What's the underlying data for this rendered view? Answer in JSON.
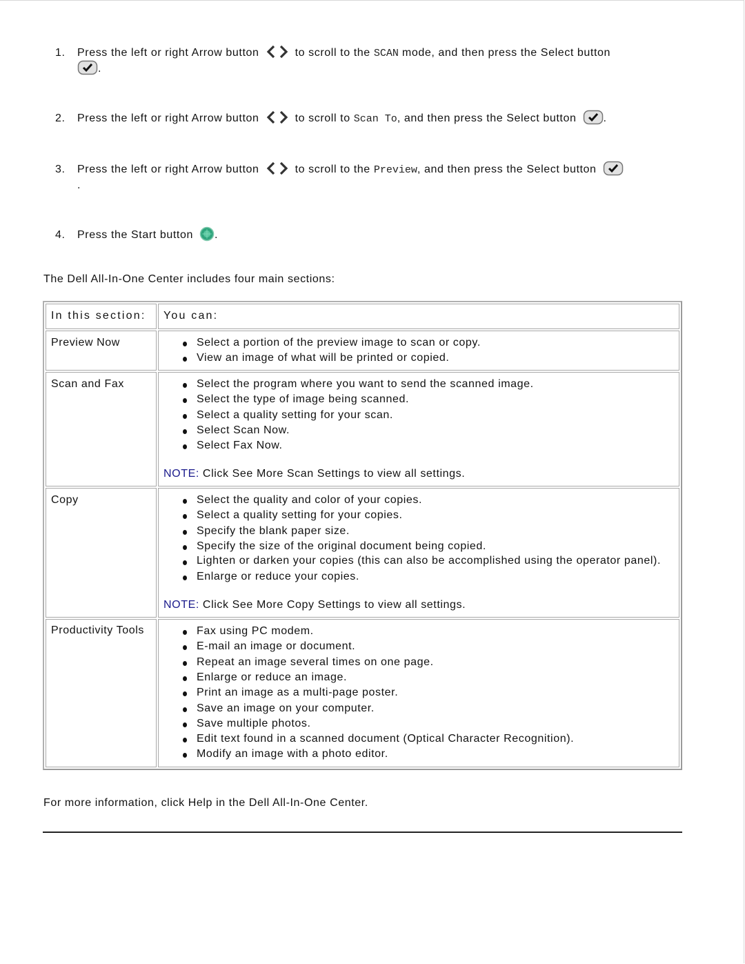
{
  "steps": [
    {
      "number": "1.",
      "text_a": "Press the left or right Arrow button",
      "text_b": "to scroll to the",
      "mode": "SCAN",
      "text_c": "mode, and then press the Select button",
      "text_end": "."
    },
    {
      "number": "2.",
      "text_a": "Press the left or right Arrow button",
      "text_b": "to scroll to",
      "mode": "Scan To",
      "text_c": ", and then press the Select button",
      "text_end": "."
    },
    {
      "number": "3.",
      "text_a": "Press the left or right Arrow button",
      "text_b": "to scroll to the",
      "mode": "Preview",
      "text_c": ", and then press the Select button",
      "text_end": "."
    },
    {
      "number": "4.",
      "text_a": "Press the Start button",
      "text_end": "."
    }
  ],
  "icons": {
    "arrow": "left-right-arrow-buttons",
    "select": "select-checkmark-button",
    "start": "start-button-green"
  },
  "intro": "The Dell All-In-One Center includes four main sections:",
  "table": {
    "headers": [
      "In this section:",
      "You can:"
    ],
    "rows": [
      {
        "section": "Preview Now",
        "items": [
          "Select a portion of the preview image to scan or copy.",
          "View an image of what will be printed or copied."
        ]
      },
      {
        "section": "Scan and Fax",
        "items": [
          "Select the program where you want to send the scanned image.",
          "Select the type of image being scanned.",
          "Select a quality setting for your scan.",
          "Select Scan Now.",
          "Select Fax Now."
        ],
        "note_label": "NOTE:",
        "note_text": " Click See More Scan Settings to view all settings."
      },
      {
        "section": "Copy",
        "items": [
          "Select the quality and color of your copies.",
          "Select a quality setting for your copies.",
          "Specify the blank paper size.",
          "Specify the size of the original document being copied.",
          "Lighten or darken your copies (this can also be accomplished using the operator panel).",
          "Enlarge or reduce your copies."
        ],
        "note_label": "NOTE:",
        "note_text": " Click See More Copy Settings to view all settings."
      },
      {
        "section": "Productivity Tools",
        "items": [
          "Fax using PC modem.",
          "E-mail an image or document.",
          "Repeat an image several times on one page.",
          "Enlarge or reduce an image.",
          "Print an image as a multi-page poster.",
          "Save an image on your computer.",
          "Save multiple photos.",
          "Edit text found in a scanned document (Optical Character Recognition).",
          "Modify an image with a photo editor."
        ]
      }
    ]
  },
  "footer": "For more information, click Help in the Dell All-In-One Center.",
  "colors": {
    "note_label": "#1a1a8c",
    "table_border": "#a8a8a8",
    "start_button": "#2fa57d"
  }
}
